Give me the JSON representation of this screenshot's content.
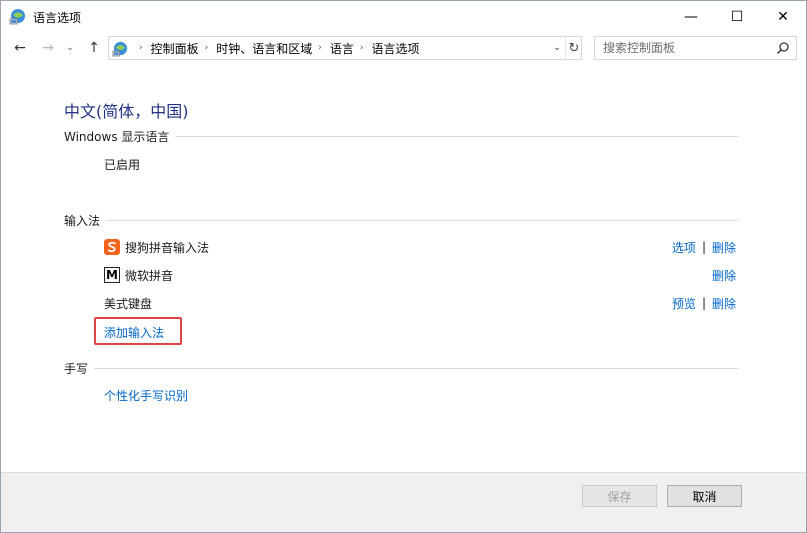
{
  "window": {
    "title": "语言选项",
    "minimize_glyph": "—",
    "maximize_glyph": "☐",
    "close_glyph": "✕"
  },
  "nav": {
    "back_glyph": "←",
    "forward_glyph": "→",
    "recent_glyph": "⌄",
    "up_glyph": "↑",
    "breadcrumbs": [
      "控制面板",
      "时钟、语言和区域",
      "语言",
      "语言选项"
    ],
    "crumb_separator": "›",
    "dropdown_glyph": "⌄",
    "refresh_glyph": "↻"
  },
  "search": {
    "placeholder": "搜索控制面板"
  },
  "language": {
    "title": "中文(简体，中国)"
  },
  "display_language": {
    "heading": "Windows 显示语言",
    "status": "已启用"
  },
  "input_methods": {
    "heading": "输入法",
    "items": [
      {
        "name": "搜狗拼音输入法",
        "icon": "sogou-ime-icon",
        "options_label": "选项",
        "remove_label": "删除"
      },
      {
        "name": "微软拼音",
        "icon": "microsoft-pinyin-icon",
        "icon_glyph": "M",
        "remove_label": "删除"
      },
      {
        "name": "美式键盘",
        "preview_label": "预览",
        "remove_label": "删除"
      }
    ],
    "add_label": "添加输入法"
  },
  "handwriting": {
    "heading": "手写",
    "personalize_label": "个性化手写识别"
  },
  "footer": {
    "save_label": "保存",
    "cancel_label": "取消"
  },
  "colors": {
    "title_blue": "#1e3287",
    "link_blue": "#0066cc",
    "highlight_red": "#e04545"
  }
}
